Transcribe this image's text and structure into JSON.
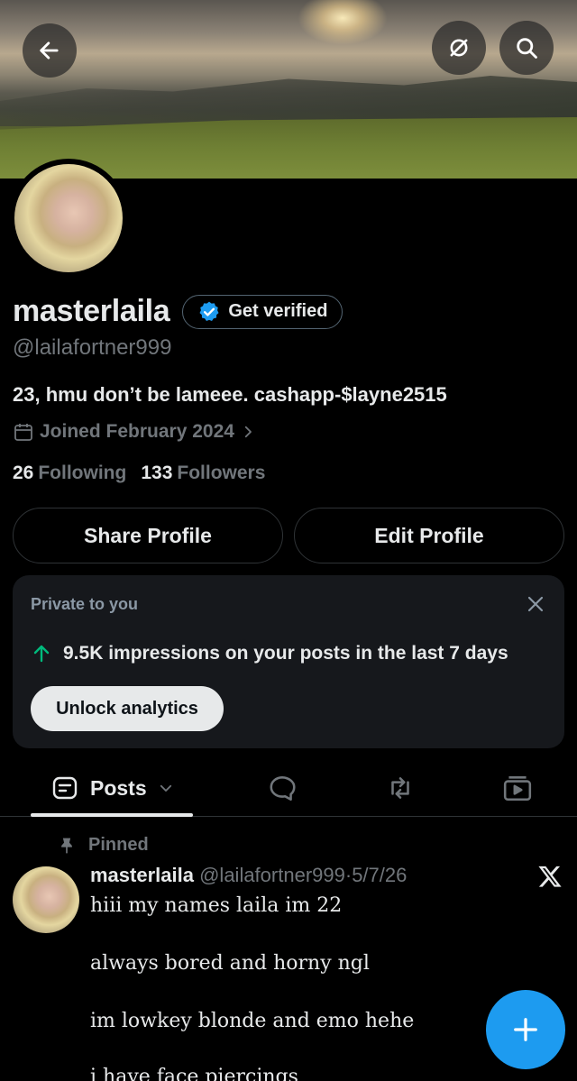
{
  "header": {
    "back_icon": "arrow-left-icon",
    "grok_icon": "slashed-circle-icon",
    "search_icon": "search-icon"
  },
  "profile": {
    "display_name": "masterlaila",
    "get_verified_label": "Get verified",
    "handle": "@lailafortner999",
    "bio": "23, hmu don’t be lameee. cashapp-$layne2515",
    "joined": "Joined February 2024",
    "following_count": "26",
    "following_label": "Following",
    "followers_count": "133",
    "followers_label": "Followers",
    "share_button": "Share Profile",
    "edit_button": "Edit Profile"
  },
  "analytics_card": {
    "label": "Private to you",
    "impressions_text": "9.5K impressions on your posts in the last 7 days",
    "unlock_button": "Unlock analytics"
  },
  "tabs": {
    "posts_label": "Posts"
  },
  "pinned_post": {
    "pinned_label": "Pinned",
    "author_name": "masterlaila",
    "author_handle": "@lailafortner999",
    "separator": "·",
    "date": "5/7/26",
    "lines": [
      "hiii my names laila im 22",
      "always bored and horny ngl",
      "im lowkey blonde and emo hehe",
      "i have face piercings"
    ]
  },
  "colors": {
    "background": "#000000",
    "accent": "#1d9bf0",
    "secondary_text": "#71767b",
    "card_bg": "#16181c",
    "positive": "#00ba7c"
  }
}
